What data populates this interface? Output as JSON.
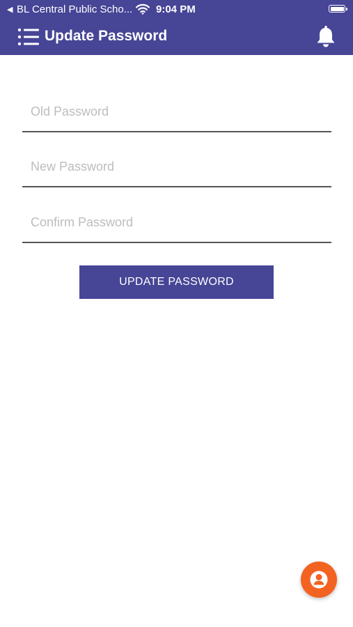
{
  "status_bar": {
    "back_glyph": "◀",
    "carrier": "BL Central Public Scho...",
    "time": "9:04 PM"
  },
  "header": {
    "title": "Update Password",
    "menu_icon": "menu-list-icon",
    "notification_icon": "bell-icon"
  },
  "form": {
    "old_password": {
      "value": "",
      "placeholder": "Old Password"
    },
    "new_password": {
      "value": "",
      "placeholder": "New Password"
    },
    "confirm_password": {
      "value": "",
      "placeholder": "Confirm Password"
    },
    "submit_label": "UPDATE PASSWORD"
  },
  "fab": {
    "icon": "user-account-icon"
  },
  "colors": {
    "primary": "#464596",
    "accent": "#f26322",
    "background": "#ffffff",
    "input_line": "#555555",
    "placeholder": "#bdbdbd"
  }
}
